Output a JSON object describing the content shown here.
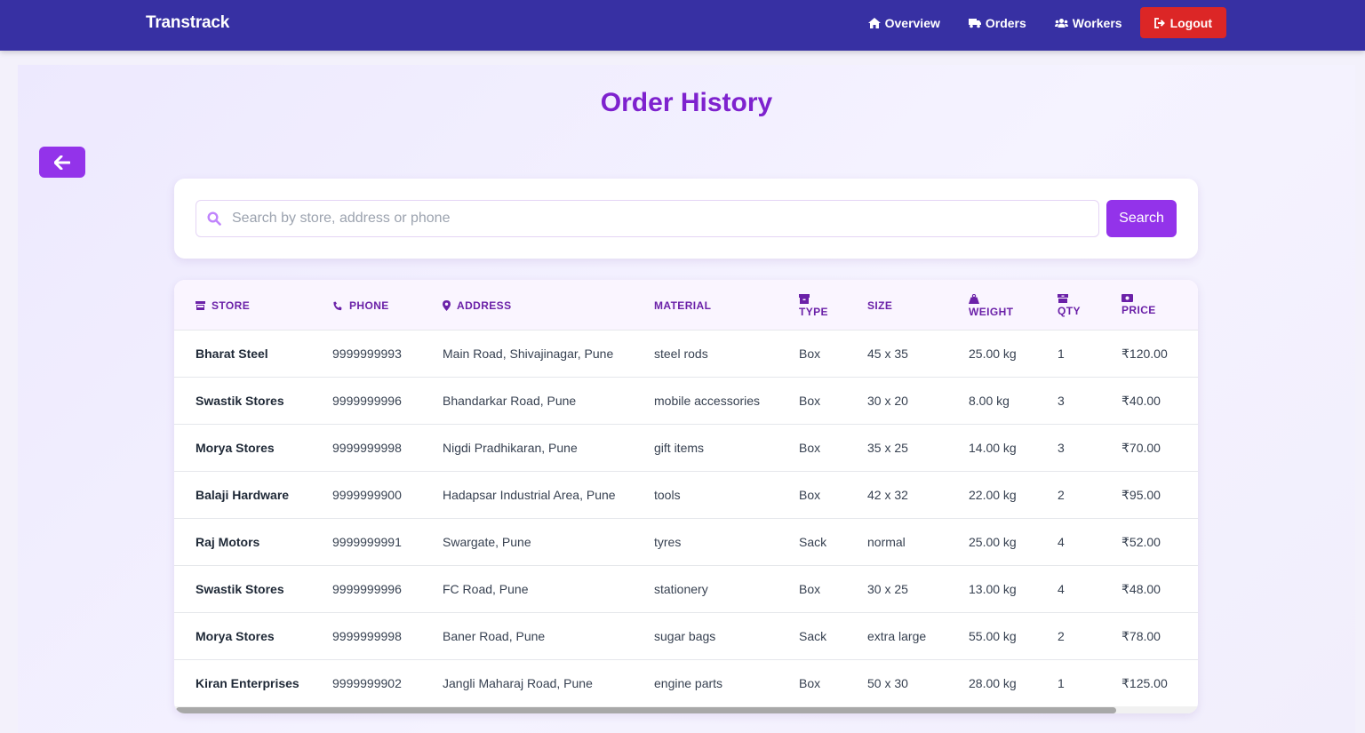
{
  "navbar": {
    "brand": "Transtrack",
    "links": [
      {
        "label": "Overview",
        "icon": "home-icon"
      },
      {
        "label": "Orders",
        "icon": "truck-icon"
      },
      {
        "label": "Workers",
        "icon": "users-icon"
      }
    ],
    "logout_label": "Logout",
    "colors": {
      "background": "#3730a3",
      "logout": "#dc2626"
    }
  },
  "page": {
    "title": "Order History",
    "accent": "#9333ea"
  },
  "search": {
    "placeholder": "Search by store, address or phone",
    "value": "",
    "button_label": "Search"
  },
  "table": {
    "headers": {
      "store": "STORE",
      "phone": "PHONE",
      "address": "ADDRESS",
      "material": "MATERIAL",
      "type": "TYPE",
      "size": "SIZE",
      "weight": "WEIGHT",
      "qty": "QTY",
      "price": "PRICE"
    },
    "rows": [
      {
        "store": "Bharat Steel",
        "phone": "9999999993",
        "address": "Main Road, Shivajinagar, Pune",
        "material": "steel rods",
        "type": "Box",
        "size": "45 x 35",
        "weight": "25.00 kg",
        "qty": "1",
        "price": "₹120.00"
      },
      {
        "store": "Swastik Stores",
        "phone": "9999999996",
        "address": "Bhandarkar Road, Pune",
        "material": "mobile accessories",
        "type": "Box",
        "size": "30 x 20",
        "weight": "8.00 kg",
        "qty": "3",
        "price": "₹40.00"
      },
      {
        "store": "Morya Stores",
        "phone": "9999999998",
        "address": "Nigdi Pradhikaran, Pune",
        "material": "gift items",
        "type": "Box",
        "size": "35 x 25",
        "weight": "14.00 kg",
        "qty": "3",
        "price": "₹70.00"
      },
      {
        "store": "Balaji Hardware",
        "phone": "9999999900",
        "address": "Hadapsar Industrial Area, Pune",
        "material": "tools",
        "type": "Box",
        "size": "42 x 32",
        "weight": "22.00 kg",
        "qty": "2",
        "price": "₹95.00"
      },
      {
        "store": "Raj Motors",
        "phone": "9999999991",
        "address": "Swargate, Pune",
        "material": "tyres",
        "type": "Sack",
        "size": "normal",
        "weight": "25.00 kg",
        "qty": "4",
        "price": "₹52.00"
      },
      {
        "store": "Swastik Stores",
        "phone": "9999999996",
        "address": "FC Road, Pune",
        "material": "stationery",
        "type": "Box",
        "size": "30 x 25",
        "weight": "13.00 kg",
        "qty": "4",
        "price": "₹48.00"
      },
      {
        "store": "Morya Stores",
        "phone": "9999999998",
        "address": "Baner Road, Pune",
        "material": "sugar bags",
        "type": "Sack",
        "size": "extra large",
        "weight": "55.00 kg",
        "qty": "2",
        "price": "₹78.00"
      },
      {
        "store": "Kiran Enterprises",
        "phone": "9999999902",
        "address": "Jangli Maharaj Road, Pune",
        "material": "engine parts",
        "type": "Box",
        "size": "50 x 30",
        "weight": "28.00 kg",
        "qty": "1",
        "price": "₹125.00"
      }
    ]
  }
}
